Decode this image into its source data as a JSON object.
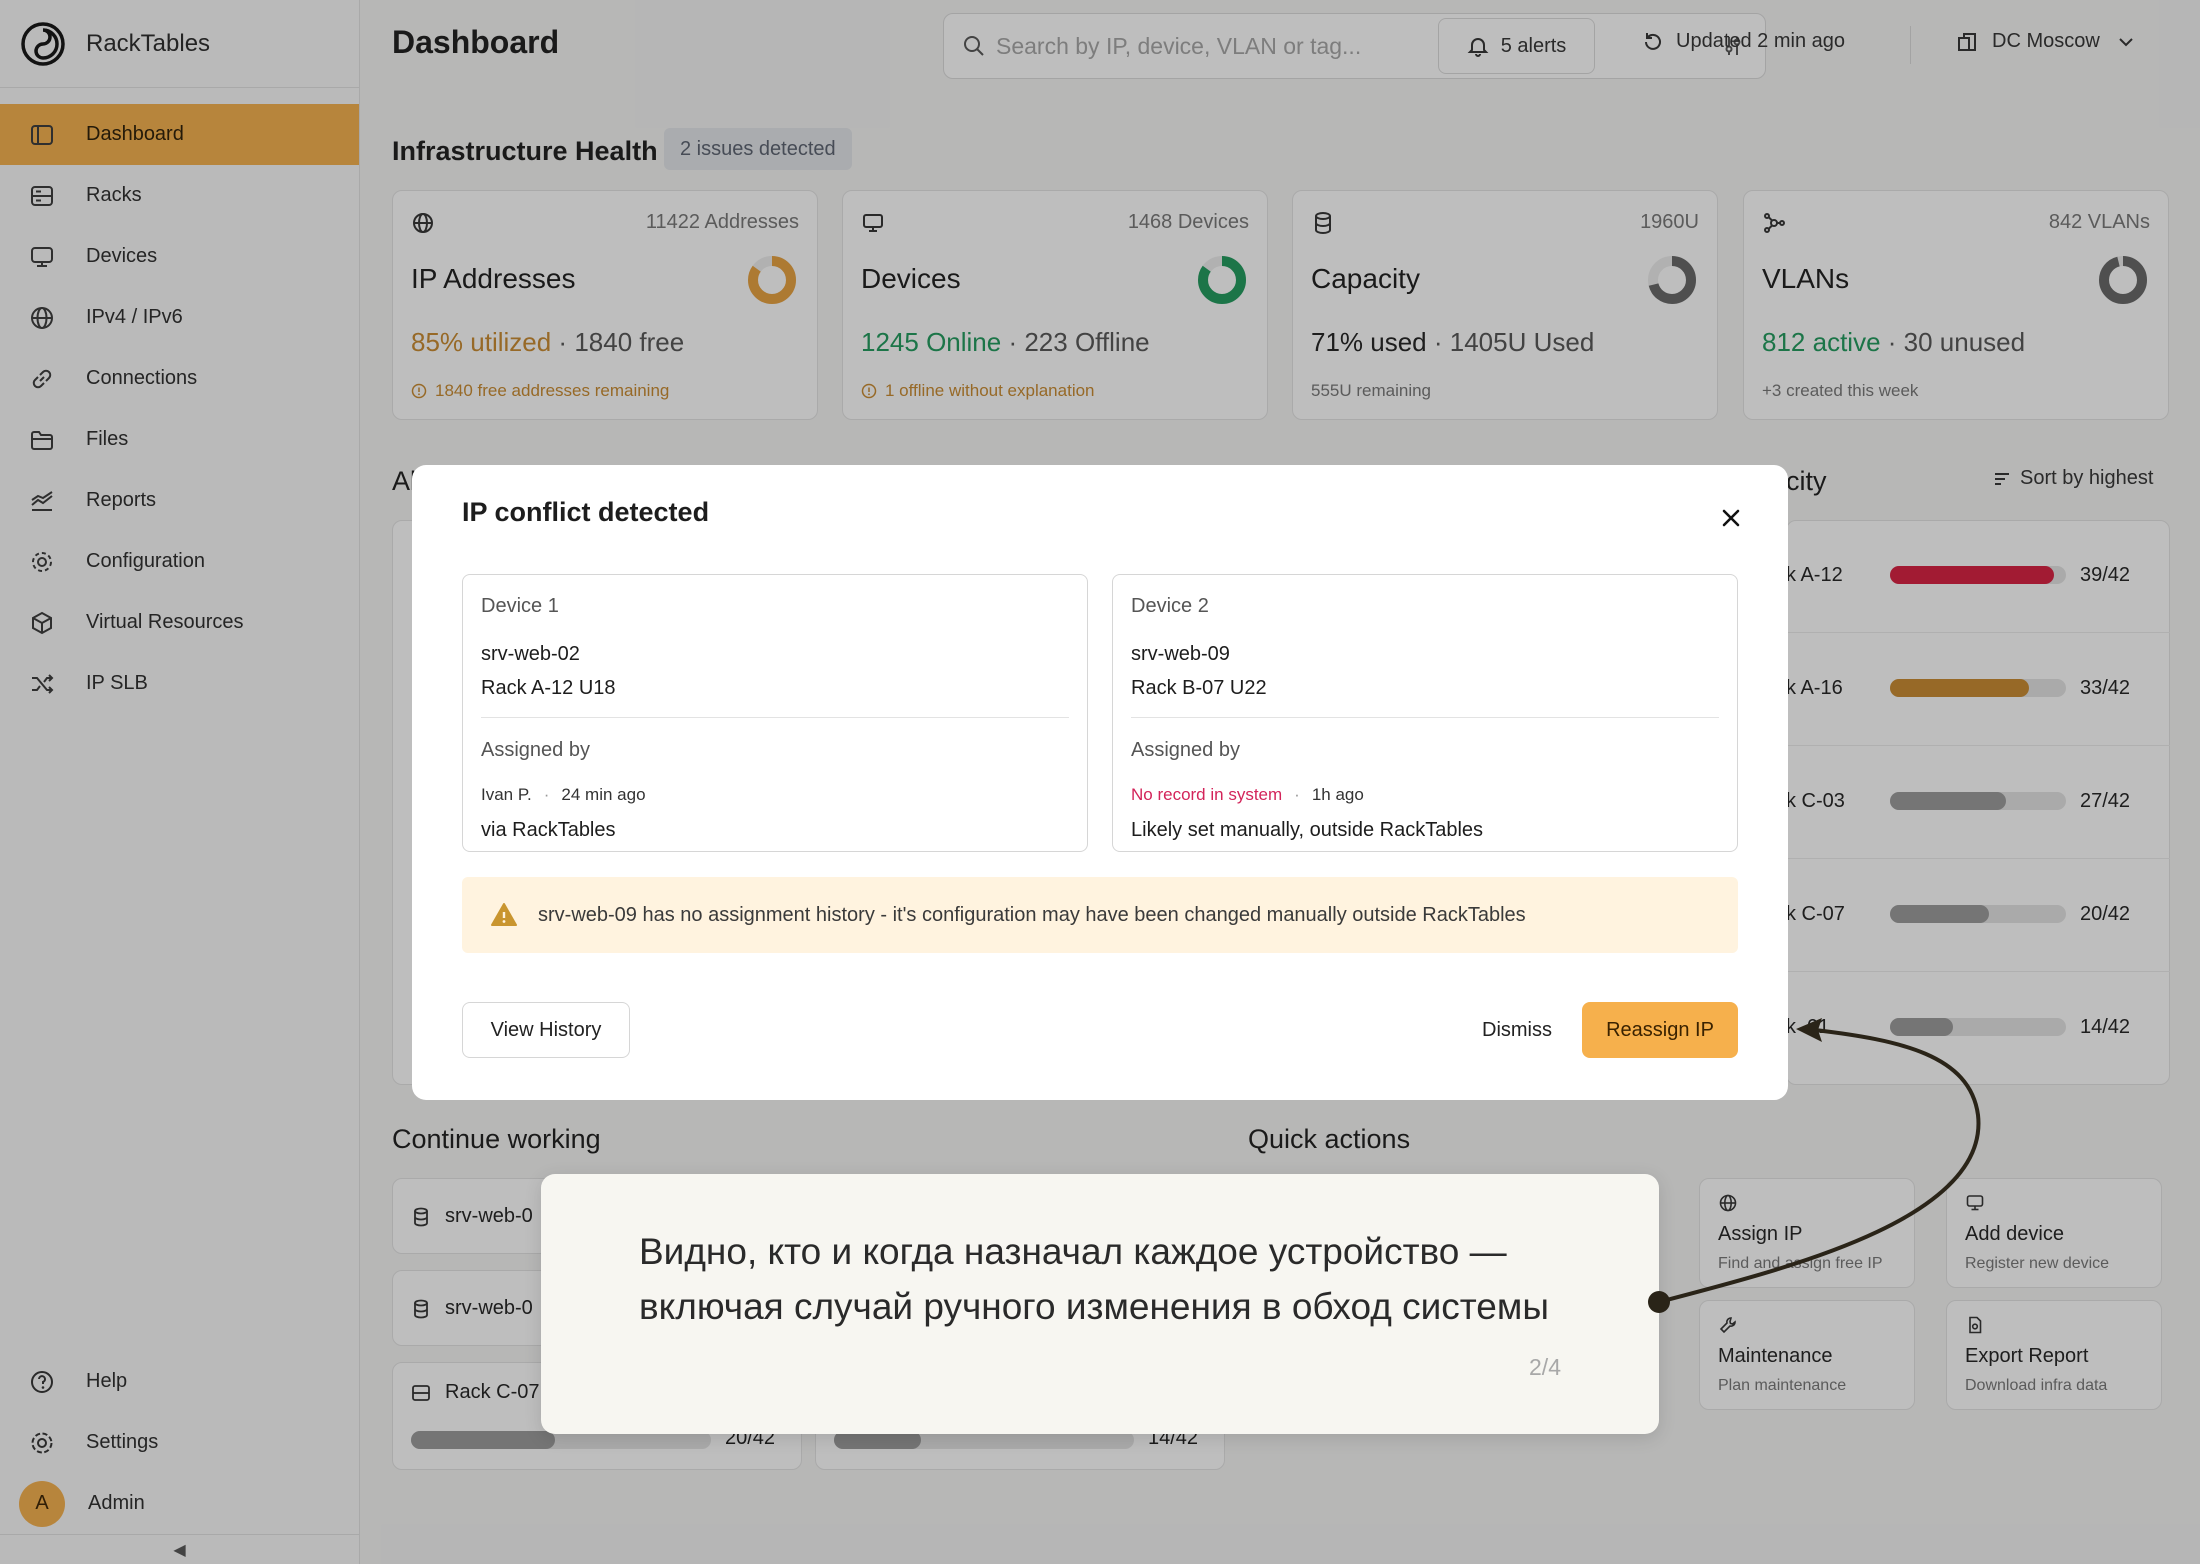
{
  "app": {
    "name": "RackTables"
  },
  "sidebar": {
    "items": [
      {
        "label": "Dashboard",
        "icon": "dashboard-icon"
      },
      {
        "label": "Racks",
        "icon": "rack-icon"
      },
      {
        "label": "Devices",
        "icon": "monitor-icon"
      },
      {
        "label": "IPv4 / IPv6",
        "icon": "globe-icon"
      },
      {
        "label": "Connections",
        "icon": "link-icon"
      },
      {
        "label": "Files",
        "icon": "folder-icon"
      },
      {
        "label": "Reports",
        "icon": "chart-icon"
      },
      {
        "label": "Configuration",
        "icon": "cog-icon"
      },
      {
        "label": "Virtual Resources",
        "icon": "cube-icon"
      },
      {
        "label": "IP SLB",
        "icon": "shuffle-icon"
      }
    ],
    "help": "Help",
    "settings": "Settings",
    "user": {
      "initial": "A",
      "name": "Admin"
    },
    "collapse_glyph": "◀"
  },
  "header": {
    "title": "Dashboard",
    "search_placeholder": "Search by IP, device, VLAN or tag...",
    "alerts": "5 alerts",
    "updated": "Updated 2 min ago",
    "datacenter": "DC Moscow"
  },
  "health": {
    "title": "Infrastructure Health",
    "badge": "2 issues detected",
    "cards": [
      {
        "count": "11422 Addresses",
        "title": "IP Addresses",
        "stat_primary": "85% utilized",
        "stat_secondary": "1840 free",
        "note": "1840 free addresses remaining",
        "ratio": 0.85,
        "color": "#e8a13e",
        "primary_color": "#c98a2e",
        "note_color": "#c98a2e"
      },
      {
        "count": "1468 Devices",
        "title": "Devices",
        "stat_primary": "1245 Online",
        "stat_secondary": "223 Offline",
        "note": "1 offline without explanation",
        "ratio": 0.85,
        "color": "#1f9a5c",
        "primary_color": "#1f9a5c",
        "note_color": "#c98a2e"
      },
      {
        "count": "1960U",
        "title": "Capacity",
        "stat_primary": "71% used",
        "stat_secondary": "1405U Used",
        "note": "555U remaining",
        "ratio": 0.71,
        "color": "#666666",
        "primary_color": "#222222",
        "note_color": "#777777"
      },
      {
        "count": "842 VLANs",
        "title": "VLANs",
        "stat_primary": "812 active",
        "stat_secondary": "30 unused",
        "note": "+3 created this week",
        "ratio": 0.96,
        "color": "#666666",
        "primary_color": "#1f9a5c",
        "note_color": "#777777"
      }
    ]
  },
  "background": {
    "alerts_title_fragment": "Al",
    "capacity_title_fragment": "city",
    "sort_label": "Sort by highest",
    "racks": [
      {
        "label": "k A-12",
        "value": "39/42",
        "ratio": 0.93,
        "color": "#d81e3f"
      },
      {
        "label": "k A-16",
        "value": "33/42",
        "ratio": 0.79,
        "color": "#c98a2e"
      },
      {
        "label": "k C-03",
        "value": "27/42",
        "ratio": 0.66,
        "color": "#9a9a9a"
      },
      {
        "label": "k C-07",
        "value": "20/42",
        "ratio": 0.56,
        "color": "#9a9a9a"
      },
      {
        "label": "k  01",
        "value": "14/42",
        "ratio": 0.36,
        "color": "#9a9a9a"
      }
    ],
    "continue_title": "Continue working",
    "continue_items": [
      {
        "label": "srv-web-0"
      },
      {
        "label": "srv-web-0"
      },
      {
        "label": "Rack C-07",
        "value": "20/42",
        "ratio": 0.48
      },
      {
        "label": "",
        "value": "14/42",
        "ratio": 0.29
      }
    ],
    "quick_title": "Quick actions",
    "quick_actions": [
      {
        "title": "Assign IP",
        "sub": "Find and assign free IP",
        "icon": "globe-icon"
      },
      {
        "title": "Add device",
        "sub": "Register new device",
        "icon": "monitor-icon"
      },
      {
        "title": "Maintenance",
        "sub": "Plan maintenance",
        "icon": "wrench-icon"
      },
      {
        "title": "Export Report",
        "sub": "Download infra data",
        "icon": "file-icon"
      }
    ]
  },
  "modal": {
    "title": "IP conflict detected",
    "device1": {
      "label": "Device 1",
      "name": "srv-web-02",
      "rack": "Rack A-12 U18",
      "assigned_label": "Assigned by",
      "assigned_by": "Ivan P.",
      "time": "24 min ago",
      "via": "via RackTables"
    },
    "device2": {
      "label": "Device 2",
      "name": "srv-web-09",
      "rack": "Rack B-07 U22",
      "assigned_label": "Assigned by",
      "assigned_by": "No record in system",
      "time": "1h ago",
      "via": "Likely set manually, outside RackTables"
    },
    "warning": "srv-web-09 has no assignment history - it's configuration may have been changed manually outside RackTables",
    "view_history": "View History",
    "dismiss": "Dismiss",
    "reassign": "Reassign IP"
  },
  "tooltip": {
    "text": "Видно, кто и когда назначал каждое устройство — включая случай ручного изменения в обход системы",
    "step": "2/4"
  }
}
